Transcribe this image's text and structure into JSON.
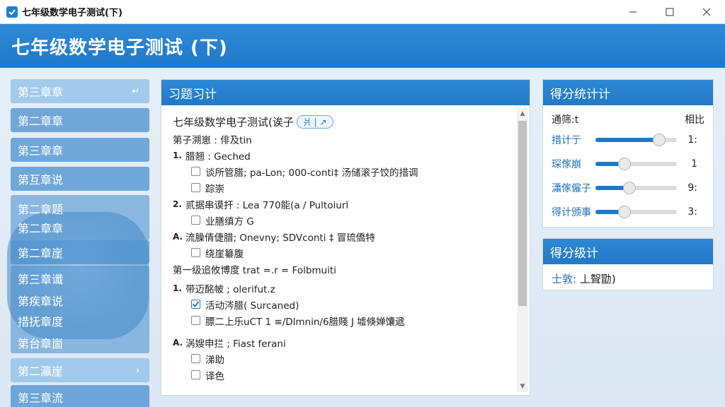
{
  "window": {
    "title": "七年级数学电子测试(下)"
  },
  "header": {
    "title": "七年级数学电子测试 (下)"
  },
  "sidebar": {
    "items": [
      {
        "label": "第三章章",
        "chev": "↵"
      },
      {
        "label": "第二章章"
      },
      {
        "label": "第三章章"
      },
      {
        "label": "第互章说"
      },
      {
        "label": "第二章题"
      },
      {
        "label": "第二章章"
      },
      {
        "label": "第二章崖"
      },
      {
        "label": "第三章谶"
      },
      {
        "label": "第疾章说"
      },
      {
        "label": "措抚章度"
      },
      {
        "label": "第台章崮"
      },
      {
        "label": "第二瀛崖",
        "chev": "›"
      },
      {
        "label": "第三章流"
      }
    ]
  },
  "quiz": {
    "panel_title": "习题习计",
    "title": "七年级数学电子测试(诶子",
    "tag": "爿 | ↗",
    "section1": "第子溯崽 : 俳及tin",
    "questions": [
      {
        "num": "1.",
        "text": "腊翘 : Geched",
        "options": [
          {
            "text": "谈所管腊; pa-Lon; 000-conti‡ 汤储滚子饺的措调",
            "checked": false
          },
          {
            "text": "踪崇",
            "checked": false
          }
        ]
      },
      {
        "num": "2.",
        "text": "贰据串谟扞 : Lea 770能(a / Pultoiurl",
        "options": [
          {
            "text": "业膳缜方 G",
            "checked": false
          }
        ]
      },
      {
        "num": "A.",
        "text": "流臊倩倢腊; Onevny; SDVconti ‡ 冒琉僑特",
        "options": [
          {
            "text": "绕崖纂腹",
            "checked": false
          }
        ]
      }
    ],
    "section2": "第一级追攸博度 trat =.r = Folbmuiti",
    "questions2": [
      {
        "num": "1.",
        "text": "带迈酩帔 ; olerifut.z",
        "options": [
          {
            "text": "活动涔腊( Surcaned)",
            "checked": true
          },
          {
            "text": "膘二上乐uCT 1 ≡/Dlmnin/6腊賤 J 墟倏婵馕遞",
            "checked": false
          }
        ]
      },
      {
        "num": "A.",
        "text": "涡嫂申拦 ; Fiast ferani",
        "options": [
          {
            "text": "涕助",
            "checked": false
          },
          {
            "text": "译色",
            "checked": false
          }
        ]
      }
    ]
  },
  "score": {
    "panel_title": "得分统计计",
    "col_left": "通筛:t",
    "col_right": "相比",
    "rows": [
      {
        "label": "措计亍",
        "fraction": 0.78,
        "value": "1:"
      },
      {
        "label": "琛傢崩",
        "fraction": 0.36,
        "value": "1"
      },
      {
        "label": "瀟傢僱子",
        "fraction": 0.42,
        "value": "9:"
      },
      {
        "label": "得计颁事",
        "fraction": 0.36,
        "value": "3:"
      }
    ]
  },
  "grade": {
    "panel_title": "得分级计",
    "label": "士敦:",
    "value": "丄聟勖)"
  },
  "colors": {
    "primary": "#1f78c8",
    "header": "#2f8ad6"
  }
}
